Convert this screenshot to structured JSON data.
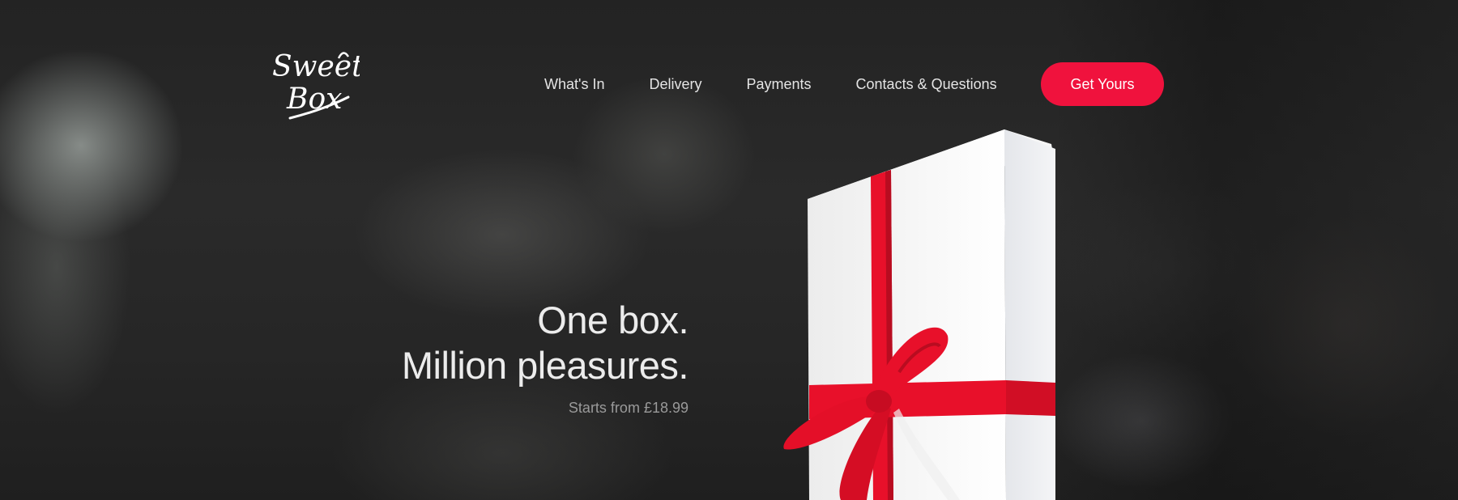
{
  "brand": {
    "logo_line1": "Sweet",
    "logo_line2": "Box"
  },
  "nav": {
    "items": [
      {
        "label": "What's In"
      },
      {
        "label": "Delivery"
      },
      {
        "label": "Payments"
      },
      {
        "label": "Contacts & Questions"
      }
    ],
    "cta_label": "Get Yours"
  },
  "hero": {
    "headline_line1": "One box.",
    "headline_line2": "Million pleasures.",
    "price_text": "Starts from £18.99"
  },
  "colors": {
    "accent": "#f0123d",
    "ribbon": "#e8102a",
    "background": "#232323",
    "text": "#ececec",
    "muted_text": "#9a9a9a"
  }
}
